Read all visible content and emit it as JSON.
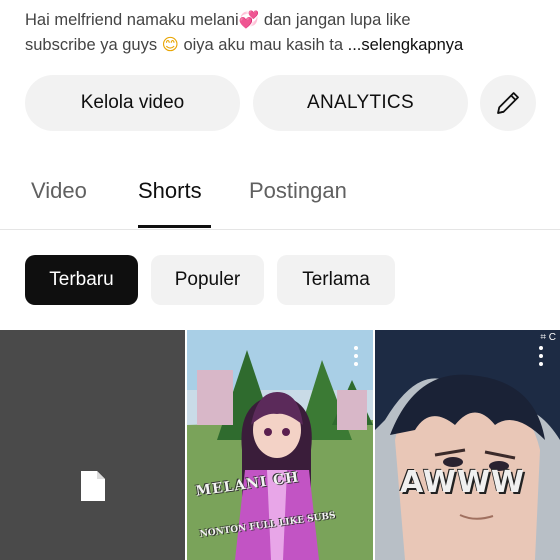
{
  "description": {
    "line1_text": "Hai melfriend namaku melani",
    "line1_emoji": "💞",
    "line1_text_after": " dan jangan lupa like",
    "line2_text": "subscribe ya guys ",
    "line2_emoji": "😊",
    "line2_text_after": " oiya aku mau kasih ta",
    "more_label": "...selengkapnya"
  },
  "actions": {
    "manage_label": "Kelola video",
    "analytics_label": "ANALYTICS",
    "edit_icon": "pencil-icon"
  },
  "tabs": [
    {
      "label": "Video",
      "active": false
    },
    {
      "label": "Shorts",
      "active": true
    },
    {
      "label": "Postingan",
      "active": false
    }
  ],
  "filters": [
    {
      "label": "Terbaru",
      "selected": true
    },
    {
      "label": "Populer",
      "selected": false
    },
    {
      "label": "Terlama",
      "selected": false
    }
  ],
  "shorts": [
    {
      "icon": "file-icon"
    },
    {
      "overlay_title": "MELANI CH",
      "overlay_subtitle": "NONTON FULL LIKE SUBS",
      "menu_icon": "more-vert-icon"
    },
    {
      "overlay_title": "AWWW",
      "corner_tag": "⌗ C",
      "menu_icon": "more-vert-icon"
    }
  ],
  "colors": {
    "chip_selected_bg": "#0f0f0f",
    "chip_bg": "#f2f2f2",
    "text_primary": "#0f0f0f",
    "text_secondary": "#606060"
  }
}
